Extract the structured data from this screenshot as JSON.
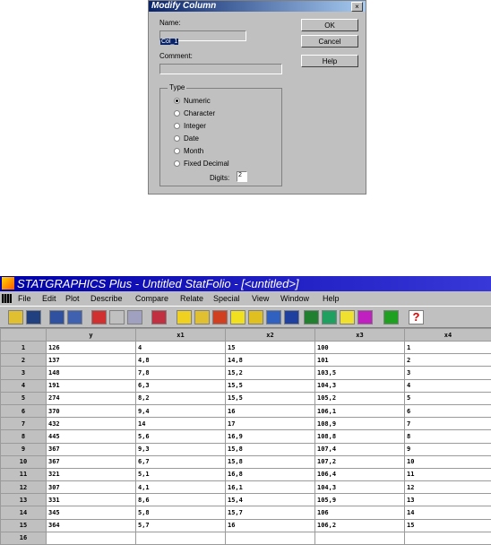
{
  "dialog": {
    "title": "Modify Column",
    "name_label": "Name:",
    "name_value": "Col_1",
    "comment_label": "Comment:",
    "comment_value": "",
    "ok_label": "OK",
    "cancel_label": "Cancel",
    "help_label": "Help",
    "type_label": "Type",
    "type_options": [
      "Numeric",
      "Character",
      "Integer",
      "Date",
      "Month",
      "Fixed Decimal"
    ],
    "selected_type": "Numeric",
    "digits_label": "Digits:",
    "digits_value": "2"
  },
  "app": {
    "title": "STATGRAPHICS Plus - Untitled StatFolio - [<untitled>]",
    "menu": [
      "File",
      "Edit",
      "Plot",
      "Describe",
      "Compare",
      "Relate",
      "Special",
      "View",
      "Window",
      "Help"
    ],
    "toolbar_icons": [
      "open-icon",
      "save-icon",
      "datasheet-icon",
      "calculator-icon",
      "cut-icon",
      "copy-icon",
      "paste-icon",
      "print-icon",
      "chart1-icon",
      "chart2-icon",
      "bar-chart-icon",
      "scatter-icon",
      "chart5-icon",
      "chart6-icon",
      "chart7-icon",
      "line-chart-icon",
      "chart9-icon",
      "chart10-icon",
      "chart11-icon",
      "arrow-icon",
      "help-icon"
    ],
    "columns": [
      "y",
      "x1",
      "x2",
      "x3",
      "x4"
    ],
    "rows": [
      [
        "1",
        "126",
        "4",
        "15",
        "100",
        "1"
      ],
      [
        "2",
        "137",
        "4,8",
        "14,8",
        "101",
        "2"
      ],
      [
        "3",
        "148",
        "7,8",
        "15,2",
        "103,5",
        "3"
      ],
      [
        "4",
        "191",
        "6,3",
        "15,5",
        "104,3",
        "4"
      ],
      [
        "5",
        "274",
        "8,2",
        "15,5",
        "105,2",
        "5"
      ],
      [
        "6",
        "370",
        "9,4",
        "16",
        "106,1",
        "6"
      ],
      [
        "7",
        "432",
        "14",
        "17",
        "108,9",
        "7"
      ],
      [
        "8",
        "445",
        "5,6",
        "16,9",
        "108,8",
        "8"
      ],
      [
        "9",
        "367",
        "9,3",
        "15,8",
        "107,4",
        "9"
      ],
      [
        "10",
        "367",
        "6,7",
        "15,8",
        "107,2",
        "10"
      ],
      [
        "11",
        "321",
        "5,1",
        "16,8",
        "106,4",
        "11"
      ],
      [
        "12",
        "307",
        "4,1",
        "16,1",
        "104,3",
        "12"
      ],
      [
        "13",
        "331",
        "8,6",
        "15,4",
        "105,9",
        "13"
      ],
      [
        "14",
        "345",
        "5,8",
        "15,7",
        "106",
        "14"
      ],
      [
        "15",
        "364",
        "5,7",
        "16",
        "106,2",
        "15"
      ],
      [
        "16",
        "",
        "",
        "",
        "",
        ""
      ]
    ]
  }
}
